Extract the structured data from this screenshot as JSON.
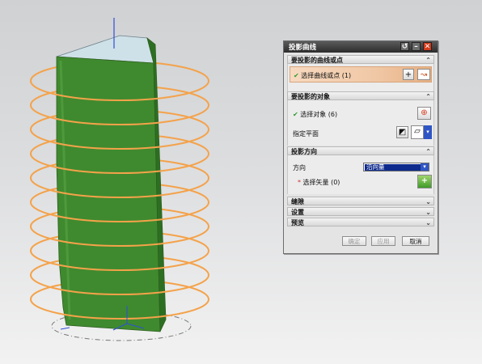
{
  "dialog": {
    "title": "投影曲线",
    "sections": {
      "curves": {
        "header": "要投影的曲线或点",
        "row_label": "选择曲线或点 (1)"
      },
      "objects": {
        "header": "要投影的对象",
        "row_label": "选择对象 (6)",
        "plane_label": "指定平面"
      },
      "direction": {
        "header": "投影方向",
        "direction_label": "方向",
        "direction_value": "沿向量",
        "select_vector": "选择矢量 (0)"
      },
      "gap": {
        "header": "缝隙"
      },
      "settings": {
        "header": "设置"
      },
      "preview": {
        "header": "预览"
      }
    },
    "buttons": {
      "ok": "确定",
      "apply": "应用",
      "cancel": "取消"
    }
  },
  "colors": {
    "solid_green": "#3f8a2e",
    "solid_top": "#c9dde6",
    "helix_orange": "#f4a24a",
    "dialog_bg": "#e4e4e4",
    "dropdown_selected": "#0e2a8c"
  },
  "icons": [
    "refresh-icon",
    "minimize-icon",
    "close-icon",
    "add-curve-icon",
    "curve-select-icon",
    "crosshair-add-icon",
    "plane-icon",
    "plane-dialog-icon",
    "vector-add-icon"
  ]
}
